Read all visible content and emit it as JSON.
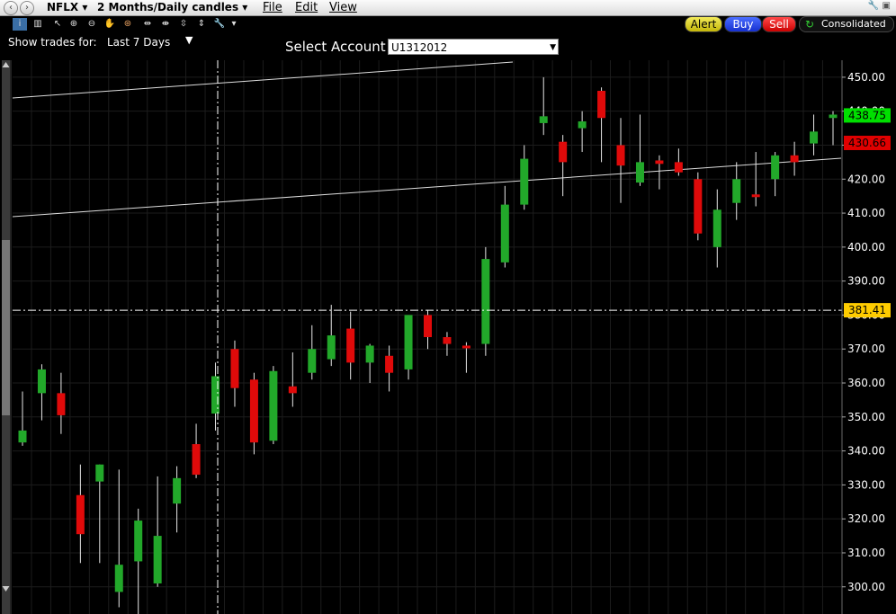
{
  "titlebar": {
    "symbol": "NFLX ▾",
    "timeframe": "2 Months/Daily candles ▾",
    "menu_file": "File",
    "menu_edit": "Edit",
    "menu_view": "View"
  },
  "toolbar": {
    "show_trades_label": "Show trades for:",
    "period_value": "Last 7 Days",
    "select_account_label": "Select Account",
    "account_value": "U1312012",
    "alert_label": "Alert",
    "buy_label": "Buy",
    "sell_label": "Sell",
    "consolidated_label": "Consolidated"
  },
  "colors": {
    "up": "#22a82a",
    "down": "#e00a0a",
    "crosshair_flag": "#ffcc00",
    "last_price_flag": "#00e000",
    "prev_price_flag": "#e00000"
  },
  "chart_data": {
    "type": "candlestick",
    "ylim": [
      292,
      455
    ],
    "y_ticks": [
      300,
      310,
      320,
      330,
      340,
      350,
      360,
      370,
      380,
      390,
      400,
      410,
      420,
      430,
      440,
      450
    ],
    "y_tick_labels": [
      "300.00",
      "310.00",
      "320.00",
      "330.00",
      "340.00",
      "350.00",
      "360.00",
      "370.00",
      "380.00",
      "390.00",
      "400.00",
      "410.00",
      "420.00",
      "430.00",
      "440.00",
      "450.00"
    ],
    "crosshair_price": "381.41",
    "last_price": "438.75",
    "prev_price": "430.66",
    "candles": [
      {
        "o": 342.5,
        "h": 357.5,
        "l": 341.5,
        "c": 346
      },
      {
        "o": 357,
        "h": 365.5,
        "l": 349,
        "c": 364
      },
      {
        "o": 357,
        "h": 363,
        "l": 345,
        "c": 350.5
      },
      {
        "o": 327,
        "h": 336,
        "l": 307,
        "c": 315.5
      },
      {
        "o": 331,
        "h": 336,
        "l": 307,
        "c": 336
      },
      {
        "o": 298.5,
        "h": 334.5,
        "l": 294,
        "c": 306.5
      },
      {
        "o": 307.5,
        "h": 323,
        "l": 292,
        "c": 319.5
      },
      {
        "o": 301,
        "h": 332.5,
        "l": 300,
        "c": 315
      },
      {
        "o": 324.5,
        "h": 335.5,
        "l": 316,
        "c": 332
      },
      {
        "o": 342,
        "h": 348,
        "l": 332,
        "c": 333
      },
      {
        "o": 351,
        "h": 366,
        "l": 346,
        "c": 362
      },
      {
        "o": 370,
        "h": 372.5,
        "l": 353,
        "c": 358.5
      },
      {
        "o": 361,
        "h": 363,
        "l": 339,
        "c": 342.5
      },
      {
        "o": 343,
        "h": 365,
        "l": 342,
        "c": 363.5
      },
      {
        "o": 359,
        "h": 369,
        "l": 353,
        "c": 357
      },
      {
        "o": 363,
        "h": 377,
        "l": 361,
        "c": 370
      },
      {
        "o": 367,
        "h": 383,
        "l": 365,
        "c": 374
      },
      {
        "o": 376,
        "h": 381,
        "l": 361,
        "c": 366
      },
      {
        "o": 366,
        "h": 371.5,
        "l": 360,
        "c": 371
      },
      {
        "o": 368,
        "h": 371,
        "l": 357.5,
        "c": 363
      },
      {
        "o": 364,
        "h": 380,
        "l": 361,
        "c": 380
      },
      {
        "o": 380,
        "h": 381.5,
        "l": 370,
        "c": 373.5
      },
      {
        "o": 373.5,
        "h": 375,
        "l": 368,
        "c": 371.5
      },
      {
        "o": 371,
        "h": 372,
        "l": 363,
        "c": 370.5
      },
      {
        "o": 371.5,
        "h": 400,
        "l": 368,
        "c": 396.5
      },
      {
        "o": 395.5,
        "h": 418,
        "l": 394,
        "c": 412.5
      },
      {
        "o": 412.5,
        "h": 430,
        "l": 411,
        "c": 426
      },
      {
        "o": 436.5,
        "h": 450,
        "l": 433,
        "c": 438.5
      },
      {
        "o": 431,
        "h": 433,
        "l": 415,
        "c": 425
      },
      {
        "o": 435,
        "h": 440,
        "l": 428,
        "c": 437
      },
      {
        "o": 446,
        "h": 447,
        "l": 425,
        "c": 438
      },
      {
        "o": 430,
        "h": 438,
        "l": 413,
        "c": 424
      },
      {
        "o": 419,
        "h": 439,
        "l": 418,
        "c": 425
      },
      {
        "o": 425.5,
        "h": 427,
        "l": 417,
        "c": 424.5
      },
      {
        "o": 425,
        "h": 429,
        "l": 421,
        "c": 422
      },
      {
        "o": 420,
        "h": 422,
        "l": 402,
        "c": 404
      },
      {
        "o": 400,
        "h": 417,
        "l": 394,
        "c": 411
      },
      {
        "o": 413,
        "h": 425,
        "l": 408,
        "c": 420
      },
      {
        "o": 415.5,
        "h": 428,
        "l": 412,
        "c": 415
      },
      {
        "o": 420,
        "h": 428,
        "l": 415,
        "c": 427
      },
      {
        "o": 427,
        "h": 431,
        "l": 421,
        "c": 425
      },
      {
        "o": 430.5,
        "h": 439,
        "l": 427,
        "c": 434
      },
      {
        "o": 438,
        "h": 440,
        "l": 430,
        "c": 439
      }
    ]
  }
}
